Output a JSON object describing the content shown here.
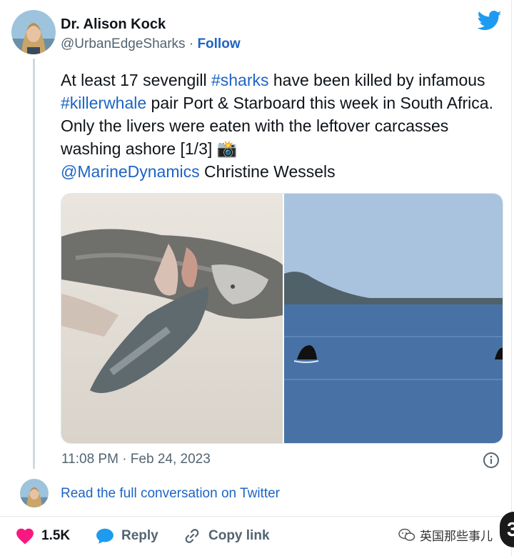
{
  "author": {
    "name": "Dr. Alison Kock",
    "handle": "@UrbanEdgeSharks",
    "separator": " · ",
    "follow_label": "Follow"
  },
  "tweet": {
    "t1": "At least 17 sevengill ",
    "tag1": "#sharks",
    "t2": " have been killed by infamous ",
    "tag2": "#killerwhale",
    "t3": " pair Port & Starboard this week in South Africa. Only the livers were eaten with the leftover carcasses washing ashore [1/3] ",
    "camera_emoji": "📸",
    "mention": "@MarineDynamics",
    "t4": " Christine Wessels"
  },
  "timestamp": "11:08 PM · Feb 24, 2023",
  "read_more": "Read the full conversation on Twitter",
  "actions": {
    "like_count": "1.5K",
    "reply_label": "Reply",
    "copy_label": "Copy link"
  },
  "watermark": {
    "text": "英国那些事儿",
    "badge": "3"
  },
  "colors": {
    "link": "#1d64c4",
    "twitter_blue": "#1d9bf0",
    "like_red": "#f91880",
    "muted": "#536471"
  },
  "icons": [
    "twitter-bird-icon",
    "info-icon",
    "heart-icon",
    "reply-bubble-icon",
    "link-icon",
    "wechat-icon"
  ]
}
